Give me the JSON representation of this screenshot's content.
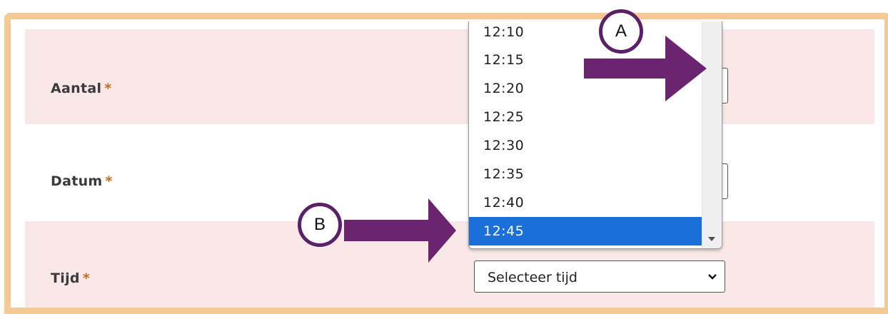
{
  "form": {
    "aantal": {
      "label": "Aantal",
      "required_mark": "*"
    },
    "datum": {
      "label": "Datum",
      "required_mark": "*"
    },
    "tijd": {
      "label": "Tijd",
      "required_mark": "*",
      "select_value": "Selecteer tijd",
      "options": [
        "12:10",
        "12:15",
        "12:20",
        "12:25",
        "12:30",
        "12:35",
        "12:40",
        "12:45"
      ],
      "highlighted_option": "12:45"
    }
  },
  "annotations": {
    "a_label": "A",
    "b_label": "B",
    "arrow_color": "#6a2470",
    "badge_border_color": "#5b2166"
  },
  "colors": {
    "frame_border": "#f5c993",
    "row_tint": "#fae8e8",
    "required_star": "#c1711b",
    "selected_option_bg": "#1a6fd9"
  },
  "icons": {
    "select_chevron": "chevron-down-icon",
    "scroll_down": "scroll-down-arrow-icon"
  }
}
